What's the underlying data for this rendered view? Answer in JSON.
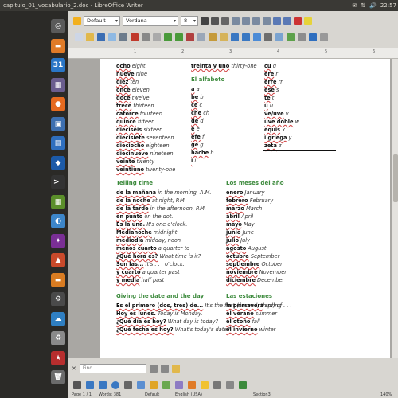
{
  "window_title": "capitulo_01_vocabulario_2.doc - LibreOffice Writer",
  "tray": {
    "mail": "✉",
    "network": "⇅",
    "volume": "🔊",
    "time": "22:57"
  },
  "toolbar": {
    "style": "Default",
    "font": "Verdana",
    "size": "8"
  },
  "ruler_ticks": [
    "1",
    "2",
    "3",
    "4",
    "5",
    "6"
  ],
  "find": {
    "placeholder": "Find"
  },
  "status": {
    "page": "Page 1 / 1",
    "words": "Words: 381",
    "style": "Default",
    "lang": "English (USA)",
    "section": "Section3",
    "zoom": "140%"
  },
  "launcher": [
    {
      "name": "dash-icon",
      "color": "#5a5a5a",
      "glyph": "◎"
    },
    {
      "name": "files-icon",
      "color": "#e07b28",
      "glyph": "▬"
    },
    {
      "name": "calendar-icon",
      "color": "#2a76c6",
      "glyph": "31"
    },
    {
      "name": "app-icon",
      "color": "#6a5d8e",
      "glyph": "▦"
    },
    {
      "name": "firefox-icon",
      "color": "#e66a1f",
      "glyph": "●"
    },
    {
      "name": "app2-icon",
      "color": "#3d6fb0",
      "glyph": "▣"
    },
    {
      "name": "writer-icon",
      "color": "#2f6fbf",
      "glyph": "▤"
    },
    {
      "name": "app3-icon",
      "color": "#1c5aa8",
      "glyph": "◆"
    },
    {
      "name": "terminal-icon",
      "color": "#333",
      "glyph": ">_"
    },
    {
      "name": "app4-icon",
      "color": "#5b8f2a",
      "glyph": "▦"
    },
    {
      "name": "app5-icon",
      "color": "#3d86c9",
      "glyph": "◐"
    },
    {
      "name": "app6-icon",
      "color": "#7a2f95",
      "glyph": "✦"
    },
    {
      "name": "app7-icon",
      "color": "#c94a2b",
      "glyph": "▲"
    },
    {
      "name": "app8-icon",
      "color": "#d97c22",
      "glyph": "▬"
    },
    {
      "name": "app9-icon",
      "color": "#4a4a4a",
      "glyph": "⚙"
    },
    {
      "name": "app10-icon",
      "color": "#2f7fc2",
      "glyph": "☁"
    },
    {
      "name": "app11-icon",
      "color": "#8a8a8a",
      "glyph": "♻"
    },
    {
      "name": "app12-icon",
      "color": "#b72e2e",
      "glyph": "★"
    },
    {
      "name": "trash-icon",
      "color": "#6b6b6b",
      "glyph": "🗑"
    }
  ],
  "col1_numbers": [
    {
      "es": "ocho",
      "en": "eight"
    },
    {
      "es": "nueve",
      "en": "nine"
    },
    {
      "es": "diez",
      "en": "ten"
    },
    {
      "es": "once",
      "en": "eleven"
    },
    {
      "es": "doce",
      "en": "twelve"
    },
    {
      "es": "trece",
      "en": "thirteen"
    },
    {
      "es": "catorce",
      "en": "fourteen"
    },
    {
      "es": "quince",
      "en": "fifteen"
    },
    {
      "es": "dieciséis",
      "en": "sixteen"
    },
    {
      "es": "diecisiete",
      "en": "seventeen"
    },
    {
      "es": "dieciocho",
      "en": "eighteen"
    },
    {
      "es": "diecinueve",
      "en": "nineteen"
    },
    {
      "es": "veinte",
      "en": "twenty"
    },
    {
      "es": "veintiuno",
      "en": "twenty-one"
    }
  ],
  "col2_top": {
    "es": "treinta y uno",
    "en": "thirty-one"
  },
  "alfabeto": {
    "heading": "El alfabeto",
    "items": [
      {
        "es": "a",
        "en": "a"
      },
      {
        "es": "be",
        "en": "b"
      },
      {
        "es": "ce",
        "en": "c"
      },
      {
        "es": "che",
        "en": "ch"
      },
      {
        "es": "de",
        "en": "d"
      },
      {
        "es": "e",
        "en": "e"
      },
      {
        "es": "efe",
        "en": "f"
      },
      {
        "es": "ge",
        "en": "g"
      },
      {
        "es": "hache",
        "en": "h"
      },
      {
        "es": "i",
        "en": "i"
      }
    ]
  },
  "col3_top": [
    {
      "es": "cu",
      "en": "q"
    },
    {
      "es": "ere",
      "en": "r"
    },
    {
      "es": "erre",
      "en": "rr"
    },
    {
      "es": "ese",
      "en": "s"
    },
    {
      "es": "te",
      "en": "t"
    },
    {
      "es": "u",
      "en": "u"
    },
    {
      "es": "ve/uve",
      "en": "v"
    },
    {
      "es": "uve doble",
      "en": "w"
    },
    {
      "es": "equis",
      "en": "x"
    },
    {
      "es": "i griega",
      "en": "y"
    },
    {
      "es": "zeta",
      "en": "z"
    }
  ],
  "telling_time": {
    "heading": "Telling time",
    "items": [
      {
        "es": "de la mañana",
        "en": "in the morning, A.M."
      },
      {
        "es": "de la noche",
        "en": "at night, P.M."
      },
      {
        "es": "de la tarde",
        "en": "in the afternoon, P.M."
      },
      {
        "es": "en punto",
        "en": "on the dot."
      },
      {
        "es": "Es la una.",
        "en": "It's one o'clock."
      },
      {
        "es": "Medianoche",
        "en": "midnight"
      },
      {
        "es": "mediodía",
        "en": "midday, noon"
      },
      {
        "es": "menos cuarto",
        "en": "a quarter to"
      },
      {
        "es": "¿Qué hora es?",
        "en": "What time is it?"
      },
      {
        "es": "Son las...",
        "en": "It's . . . o'clock."
      },
      {
        "es": "y cuarto",
        "en": "a quarter past"
      },
      {
        "es": "y media",
        "en": "half past"
      }
    ]
  },
  "months": {
    "heading": "Los meses del año",
    "items": [
      {
        "es": "enero",
        "en": "January"
      },
      {
        "es": "febrero",
        "en": "February"
      },
      {
        "es": "marzo",
        "en": "March"
      },
      {
        "es": "abril",
        "en": "April"
      },
      {
        "es": "mayo",
        "en": "May"
      },
      {
        "es": "junio",
        "en": "June"
      },
      {
        "es": "julio",
        "en": "July"
      },
      {
        "es": "agosto",
        "en": "August"
      },
      {
        "es": "octubre",
        "en": "September"
      },
      {
        "es": "septiembre",
        "en": "October"
      },
      {
        "es": "noviembre",
        "en": "November"
      },
      {
        "es": "diciembre",
        "en": "December"
      }
    ]
  },
  "giving_date": {
    "heading": "Giving the date and the day",
    "items": [
      {
        "es": "Es el primero (dos, tres) de...",
        "en": "It's the first (second, third) of . . ."
      },
      {
        "es": "Hoy es lunes.",
        "en": "Today is Monday."
      },
      {
        "es": "¿Qué día es hoy?",
        "en": "What day is today?"
      },
      {
        "es": "¿Qué fecha es hoy?",
        "en": "What's today's date?"
      }
    ]
  },
  "seasons": {
    "heading": "Las estaciones",
    "items": [
      {
        "es": "la primavera",
        "en": "spring"
      },
      {
        "es": "el verano",
        "en": "summer"
      },
      {
        "es": "el otoño",
        "en": "fall"
      },
      {
        "es": "el invierno",
        "en": "winter"
      }
    ]
  }
}
